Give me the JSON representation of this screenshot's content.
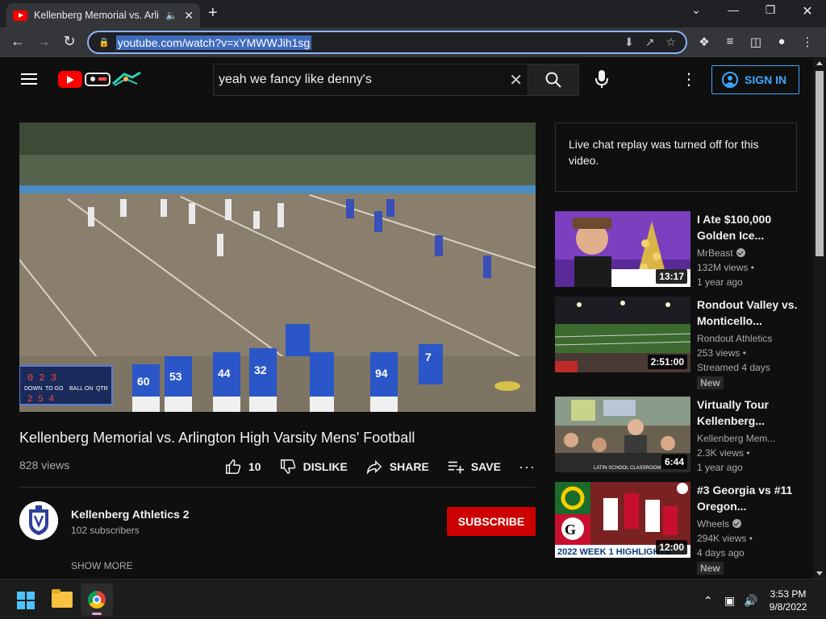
{
  "browser": {
    "tab_title": "Kellenberg Memorial vs. Arlin",
    "url": "youtube.com/watch?v=xYMWWJih1sg"
  },
  "header": {
    "search_value": "yeah we fancy like denny's",
    "signin_label": "SIGN IN"
  },
  "video": {
    "title": "Kellenberg Memorial vs. Arlington High Varsity Mens' Football",
    "views": "828 views",
    "likes": "10",
    "dislike_label": "DISLIKE",
    "share_label": "SHARE",
    "save_label": "SAVE",
    "scoreboard": [
      "DOWN",
      "TO GO",
      "BALL ON",
      "QTR"
    ],
    "jersey_numbers": [
      "60",
      "53",
      "44",
      "32",
      "94",
      "7"
    ]
  },
  "channel": {
    "name": "Kellenberg Athletics 2",
    "subscribers": "102 subscribers",
    "subscribe_label": "SUBSCRIBE",
    "show_more": "SHOW MORE"
  },
  "chat": {
    "message": "Live chat replay was turned off for this video."
  },
  "suggestions": [
    {
      "title": "I Ate $100,000 Golden Ice...",
      "channel": "MrBeast",
      "verified": true,
      "views": "132M views •",
      "age": "1 year ago",
      "duration": "13:17",
      "badge": ""
    },
    {
      "title": "Rondout Valley vs. Monticello...",
      "channel": "Rondout Athletics",
      "verified": false,
      "views": "253 views •",
      "age": "Streamed 4 days",
      "duration": "2:51:00",
      "badge": "New"
    },
    {
      "title": "Virtually Tour Kellenberg...",
      "channel": "Kellenberg Mem...",
      "verified": false,
      "views": "2.3K views •",
      "age": "1 year ago",
      "duration": "6:44",
      "badge": "",
      "thumb_caption": "LATIN SCHOOL CLASSROOM"
    },
    {
      "title": "#3 Georgia vs #11 Oregon...",
      "channel": "Wheels",
      "verified": true,
      "views": "294K views •",
      "age": "4 days ago",
      "duration": "12:00",
      "badge": "New",
      "thumb_caption": "2022 WEEK 1 HIGHLIGHTS"
    }
  ],
  "taskbar": {
    "time": "3:53 PM",
    "date": "9/8/2022"
  }
}
